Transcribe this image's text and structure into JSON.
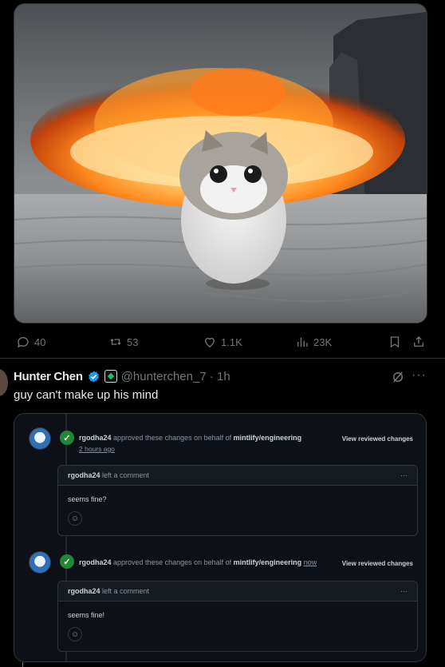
{
  "tweet1": {
    "image": {
      "alt": "Cat walking away from an explosion in a desert",
      "colors": {
        "sky": "#6f7376",
        "sand": "#b9b9b9",
        "fire": "#ff9a2a",
        "cliff": "#2a2d33"
      }
    },
    "actions": {
      "replies": "40",
      "reposts": "53",
      "likes": "1.1K",
      "views": "23K"
    }
  },
  "tweet2": {
    "author_name": "Hunter Chen",
    "handle_time": "@hunterchen_7 · 1h",
    "text": "guy can't make up his mind",
    "more": "···"
  },
  "github": {
    "reviews": [
      {
        "user": "rgodha24",
        "action": "approved these changes on behalf of",
        "team": "mintlify/engineering",
        "time": "2 hours ago",
        "view_label": "View reviewed changes",
        "comment_user": "rgodha24",
        "comment_action": "left a comment",
        "comment_more": "···",
        "comment_body": "seems fine?"
      },
      {
        "user": "rgodha24",
        "action": "approved these changes on behalf of",
        "team": "mintlify/engineering",
        "time": "now",
        "view_label": "View reviewed changes",
        "comment_user": "rgodha24",
        "comment_action": "left a comment",
        "comment_more": "···",
        "comment_body": "seems fine!"
      }
    ],
    "colors": {
      "approve": "#238636",
      "bg": "#0d1117",
      "border": "#30363d"
    }
  },
  "icons": {
    "reply": "reply-icon",
    "repost": "repost-icon",
    "like": "heart-icon",
    "views": "views-icon",
    "bookmark": "bookmark-icon",
    "share": "share-icon",
    "grok": "grok-icon",
    "verified": "verified-badge-icon"
  }
}
